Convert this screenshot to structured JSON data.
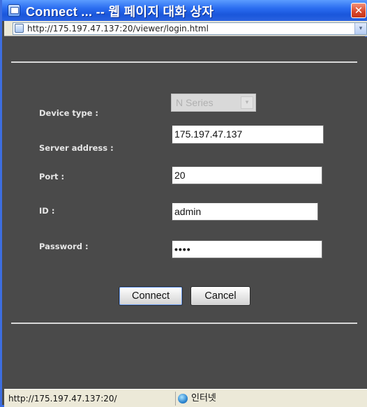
{
  "window": {
    "title": "Connect ... -- 웹 페이지 대화 상자",
    "close_glyph": "✕"
  },
  "address_bar": {
    "url": "http://175.197.47.137:20/viewer/login.html",
    "dropdown_glyph": "▾"
  },
  "form": {
    "device_type": {
      "label": "Device type  :",
      "value": "N Series",
      "disabled": true,
      "arrow_glyph": "▾"
    },
    "server_address": {
      "label": "Server address  :",
      "value": "175.197.47.137"
    },
    "port": {
      "label": "Port  :",
      "value": "20"
    },
    "id": {
      "label": "ID  :",
      "value": "admin"
    },
    "password": {
      "label": "Password  :",
      "value": "••••"
    }
  },
  "buttons": {
    "connect": "Connect",
    "cancel": "Cancel"
  },
  "status_bar": {
    "url": "http://175.197.47.137:20/",
    "zone": "인터넷"
  },
  "colors": {
    "title_bar": "#2a6cf0",
    "content_background": "#4a4a4a",
    "label_text": "#e6e6e6",
    "close_button": "#d8462a"
  },
  "icons": {
    "app": "window-icon",
    "page": "page-icon",
    "zone": "internet-globe-icon"
  }
}
